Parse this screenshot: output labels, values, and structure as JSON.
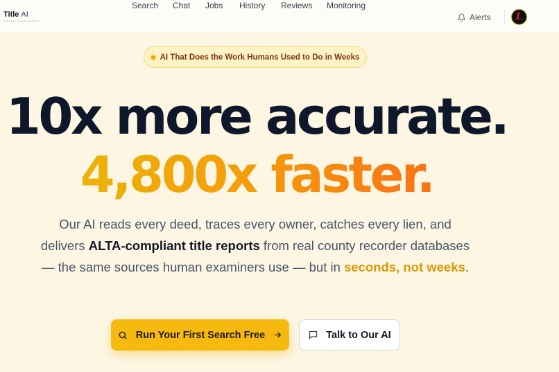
{
  "brand": {
    "name": "Title",
    "suffix": "AI",
    "tagline": "INSTANT TITLE SEARCH"
  },
  "nav": {
    "items": [
      {
        "label": "Search"
      },
      {
        "label": "Chat"
      },
      {
        "label": "Jobs"
      },
      {
        "label": "History"
      },
      {
        "label": "Reviews"
      },
      {
        "label": "Monitoring"
      }
    ]
  },
  "header": {
    "alerts_label": "Alerts",
    "avatar_initial": "L"
  },
  "hero": {
    "badge": "AI That Does the Work Humans Used to Do in Weeks",
    "headline_1": "10x more accurate.",
    "headline_2": "4,800x faster.",
    "description": {
      "part1": "Our AI reads every deed, traces every owner, catches every lien, and delivers ",
      "strong": "ALTA-compliant title reports",
      "part2": " from real county recorder databases — the same sources human examiners use — but in ",
      "highlight": "seconds, not weeks",
      "part3": "."
    },
    "primary_cta": "Run Your First Search Free",
    "secondary_cta": "Talk to Our AI"
  },
  "colors": {
    "background": "#fdf6e3",
    "accent": "#f5b90f",
    "gradient_start": "#eab308",
    "gradient_end": "#f97316",
    "headline": "#0f172a"
  }
}
